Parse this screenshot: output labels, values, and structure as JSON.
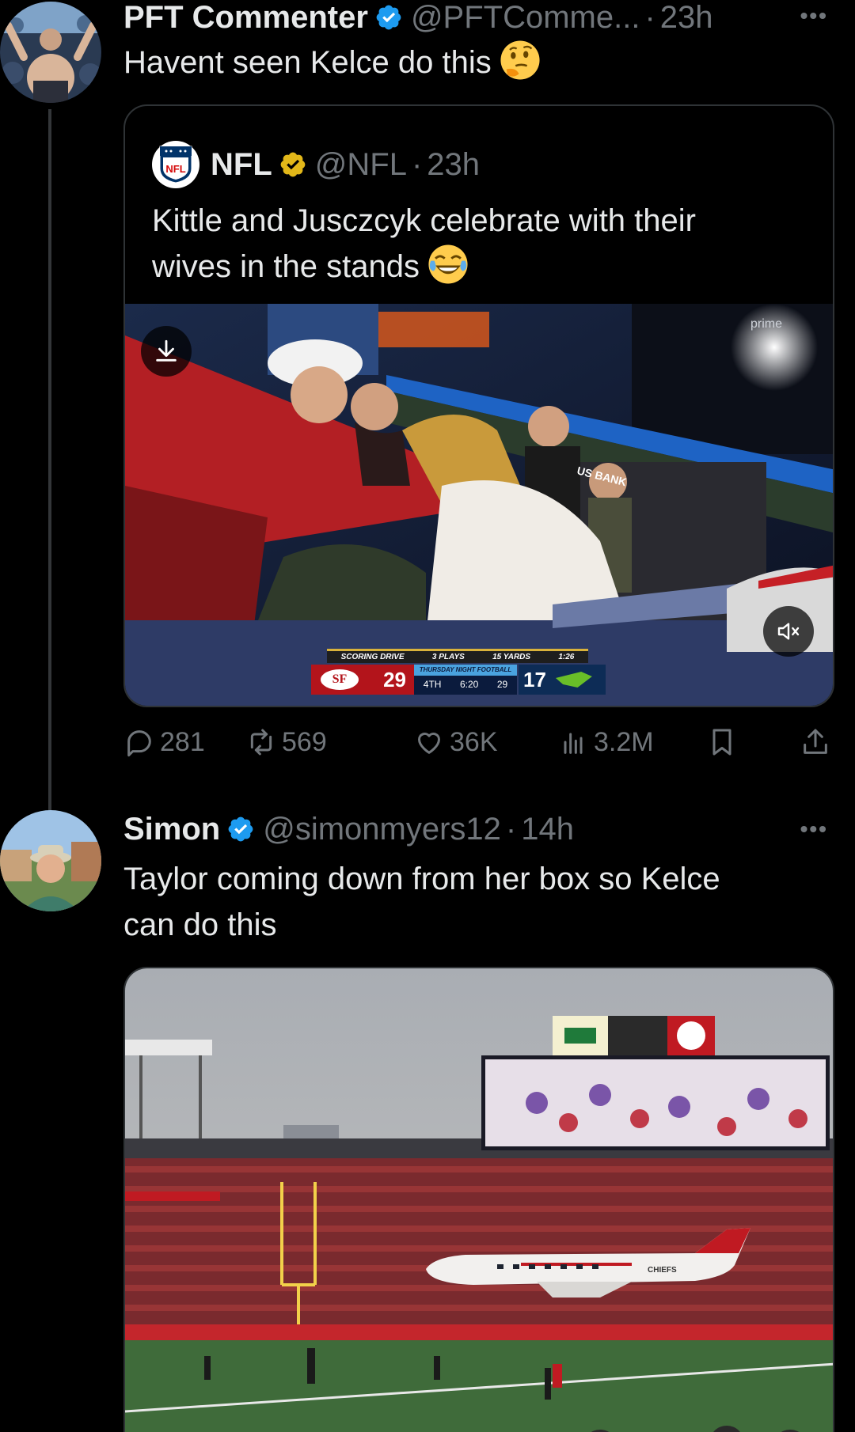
{
  "tweet1": {
    "display_name": "PFT Commenter",
    "handle": "@PFTComme...",
    "separator": "·",
    "time": "23h",
    "text": "Havent seen Kelce do this",
    "emoji": "thinking-face",
    "quote": {
      "display_name": "NFL",
      "handle": "@NFL",
      "separator": "·",
      "time": "23h",
      "text_line1": "Kittle and Jusczcyk celebrate with their",
      "text_line2": "wives in the stands",
      "emoji": "tears-of-joy",
      "video": {
        "broadcast_badge": "prime",
        "scorebug": {
          "drive": "SCORING DRIVE",
          "plays": "3 PLAYS",
          "yards": "15 YARDS",
          "duration": "1:26",
          "home_score": "29",
          "away_score": "17",
          "show": "THURSDAY NIGHT FOOTBALL",
          "quarter": "4TH",
          "clock": "6:20",
          "play_clock": "29"
        },
        "sponsor": "US BANK"
      }
    },
    "stats": {
      "replies": "281",
      "reposts": "569",
      "likes": "36K",
      "views": "3.2M"
    }
  },
  "tweet2": {
    "display_name": "Simon",
    "handle": "@simonmyers12",
    "separator": "·",
    "time": "14h",
    "text_line1": "Taylor coming down from her box so Kelce",
    "text_line2": "can do this",
    "image": {
      "plane_text": "CHIEFS"
    }
  },
  "colors": {
    "background": "#000000",
    "primary_text": "#e7e9ea",
    "secondary_text": "#71767b",
    "verified_blue": "#1d9bf0",
    "verified_gold": "#e2b719",
    "border": "#2f3336"
  }
}
